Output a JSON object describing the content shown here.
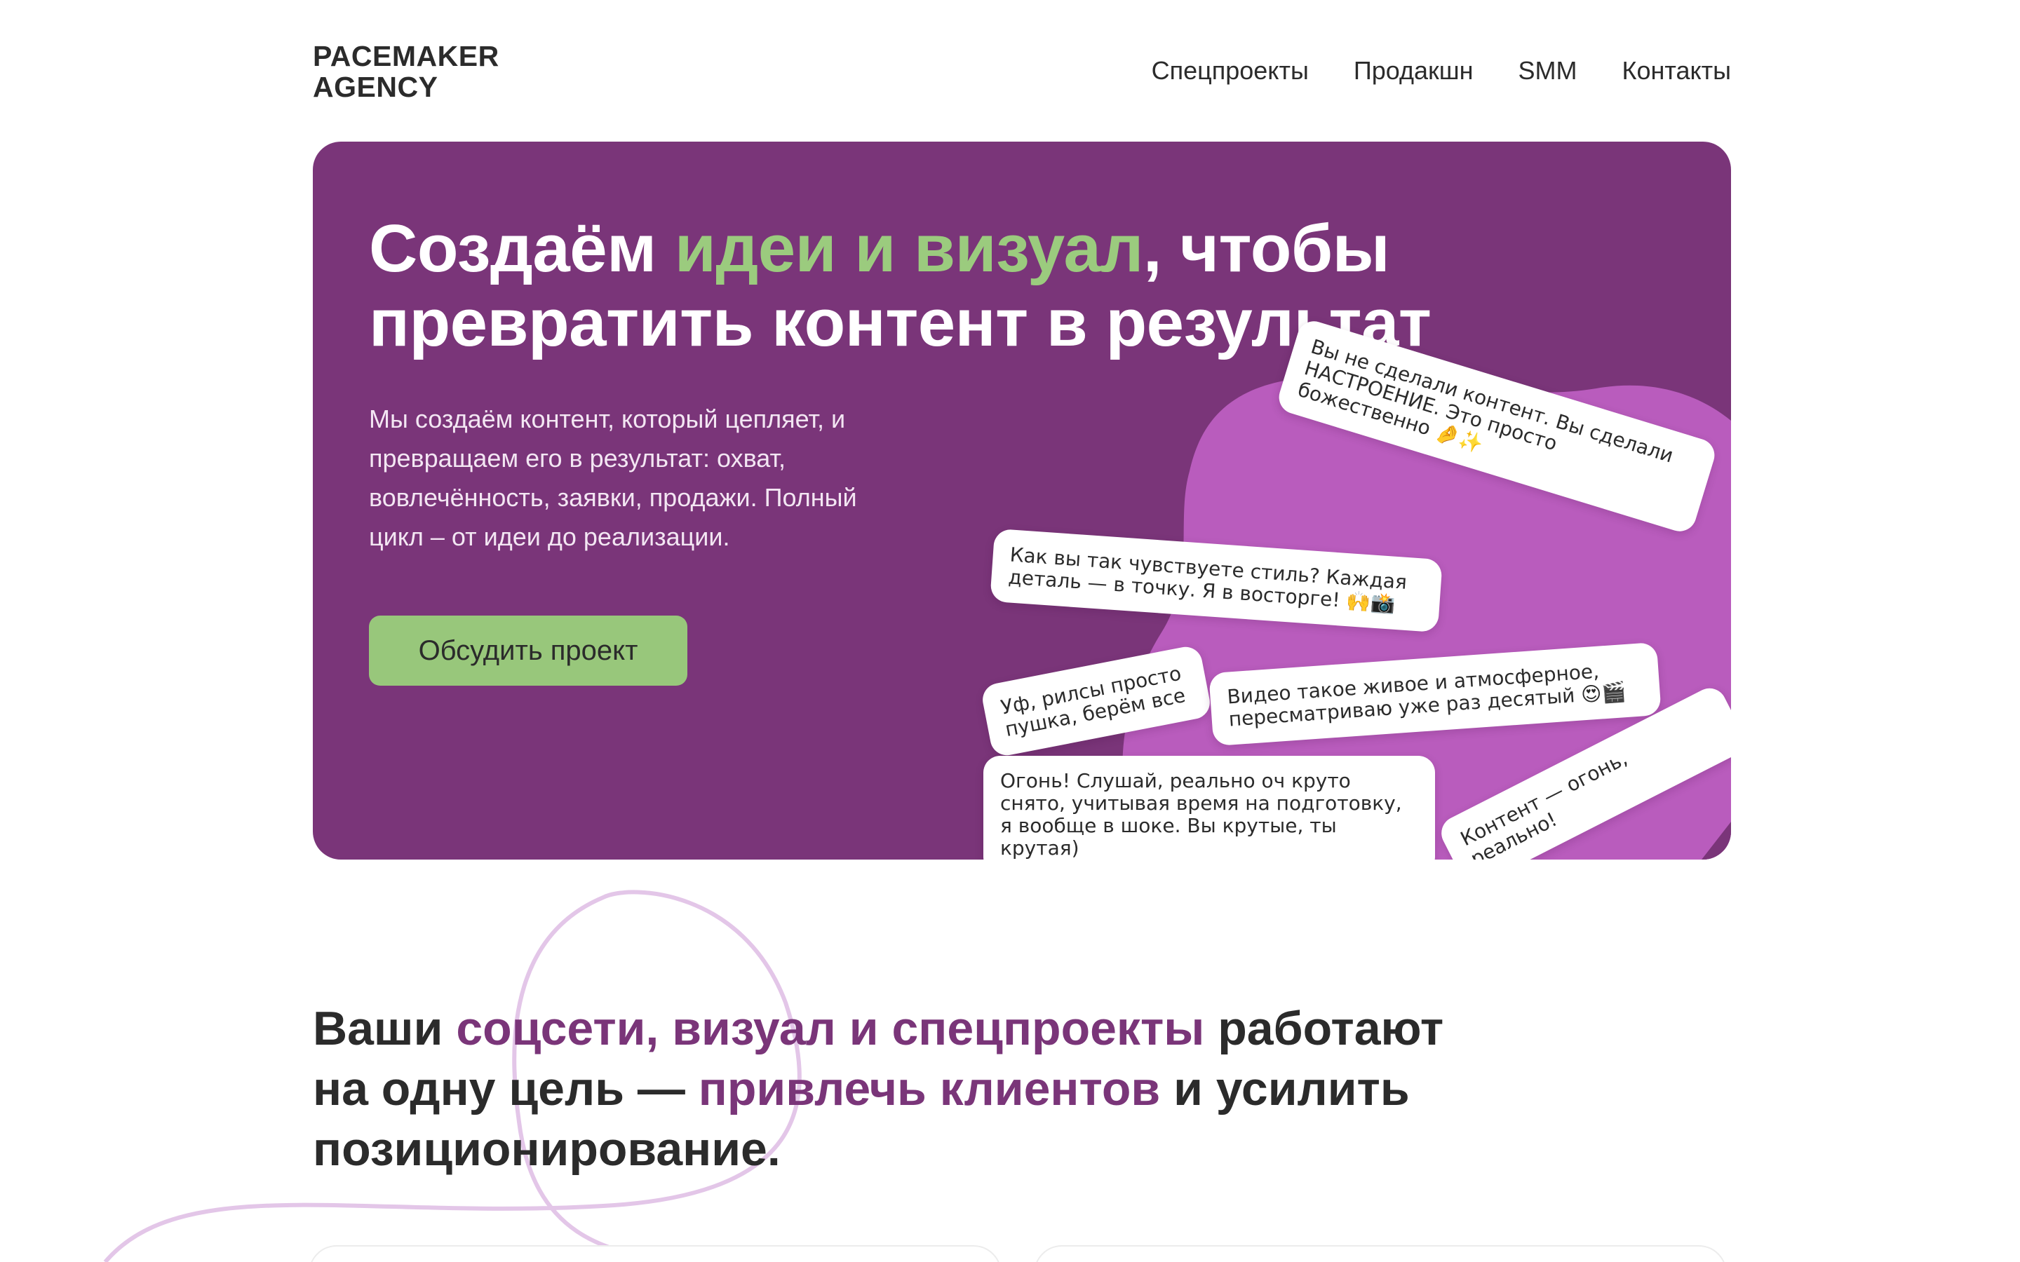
{
  "header": {
    "logo_line1": "PACEMAKER",
    "logo_line2": "AGENCY",
    "nav": [
      {
        "label": "Спецпроекты"
      },
      {
        "label": "Продакшн"
      },
      {
        "label": "SMM"
      },
      {
        "label": "Контакты"
      }
    ]
  },
  "hero": {
    "title_part1": "Создаём ",
    "title_accent": "идеи и визуал",
    "title_part2": ", чтобы превратить контент в результат",
    "description": "Мы создаём контент, который цепляет, и превращаем его в результат: охват, вовлечённость, заявки, продажи. Полный цикл – от идеи до реализации.",
    "cta_label": "Обсудить проект",
    "reviews": [
      "Вы не сделали контент. Вы сделали НАСТРОЕНИЕ. Это просто божественно 🤌✨",
      "Как вы так чувствуете стиль? Каждая деталь — в точку. Я в восторге! 🙌📸",
      "Уф, рилсы просто пушка, берём все",
      "Видео такое живое и атмосферное, пересматриваю уже раз десятый 😍🎬",
      "Огонь! Слушай, реально оч круто снято, учитывая время на подготовку, я вообще в шоке. Вы крутые, ты крутая)",
      "Контент — огонь, реально!"
    ]
  },
  "section": {
    "title_part1": "Ваши ",
    "title_accent1": "соцсети, визуал и спецпроекты",
    "title_part2": " работают на одну цель — ",
    "title_accent2": "привлечь клиентов",
    "title_part3": " и усилить позиционирование."
  },
  "colors": {
    "hero_bg": "#7a3579",
    "blob": "#b95cbd",
    "accent_green": "#9bcb7e",
    "button_bg": "#98c77b",
    "accent_purple": "#7a3579",
    "curve": "#e3c6e8"
  }
}
